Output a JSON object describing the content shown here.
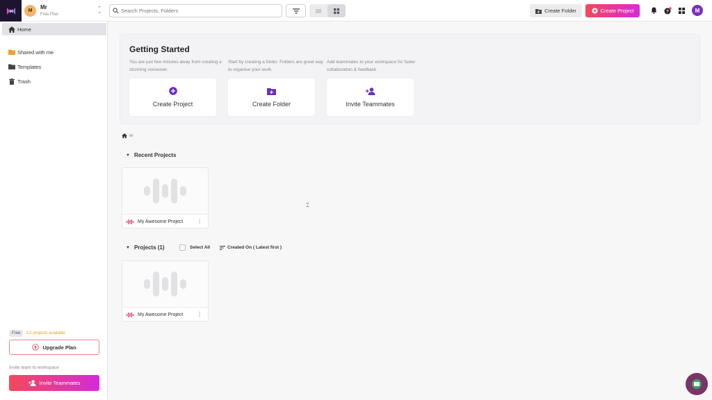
{
  "workspace": {
    "initial": "M",
    "name": "Mr",
    "plan": "Free Plan"
  },
  "search": {
    "placeholder": "Search Projects, Folders",
    "value": ""
  },
  "toolbar": {
    "create_folder_label": "Create Folder",
    "create_project_label": "Create Project"
  },
  "user": {
    "initial": "M"
  },
  "sidebar": {
    "items": [
      {
        "label": "Home",
        "icon": "home-icon",
        "active": true
      },
      {
        "label": "Shared with me",
        "icon": "shared-folder-icon",
        "active": false
      },
      {
        "label": "Templates",
        "icon": "folder-icon",
        "active": false
      },
      {
        "label": "Trash",
        "icon": "trash-icon",
        "active": false
      }
    ],
    "plan_badge": "Free",
    "plan_available": "1/2 projects available",
    "upgrade_label": "Upgrade Plan",
    "invite_text": "Invite team to workspace",
    "invite_button_label": "Invite Teammates"
  },
  "getting_started": {
    "title": "Getting Started",
    "cards": [
      {
        "desc": "You are just few minutes away from creating a stunning voiceover.",
        "label": "Create Project",
        "icon": "plus-circle-icon"
      },
      {
        "desc": "Start by creating a folder. Folders are great way to organise your work.",
        "label": "Create Folder",
        "icon": "folder-plus-icon"
      },
      {
        "desc": "Add teammates to your workspace for faster collaboration & feedback",
        "label": "Invite Teammates",
        "icon": "add-user-icon"
      }
    ]
  },
  "breadcrumb": {
    "current": "Mr"
  },
  "recent": {
    "title": "Recent Projects",
    "projects": [
      {
        "name": "My Awesome Project"
      }
    ]
  },
  "projects": {
    "title": "Projects (1)",
    "select_all": "Select All",
    "sort_label": "Created On ( Latest first )",
    "items": [
      {
        "name": "My Awesome Project"
      }
    ]
  },
  "colors": {
    "accent_start": "#f4485a",
    "accent_end": "#d62ad8",
    "purple": "#6c2fb8",
    "avatar_user": "#7b2fbe",
    "avatar_workspace": "#f6b36b",
    "plan_available": "#e6a21d"
  }
}
